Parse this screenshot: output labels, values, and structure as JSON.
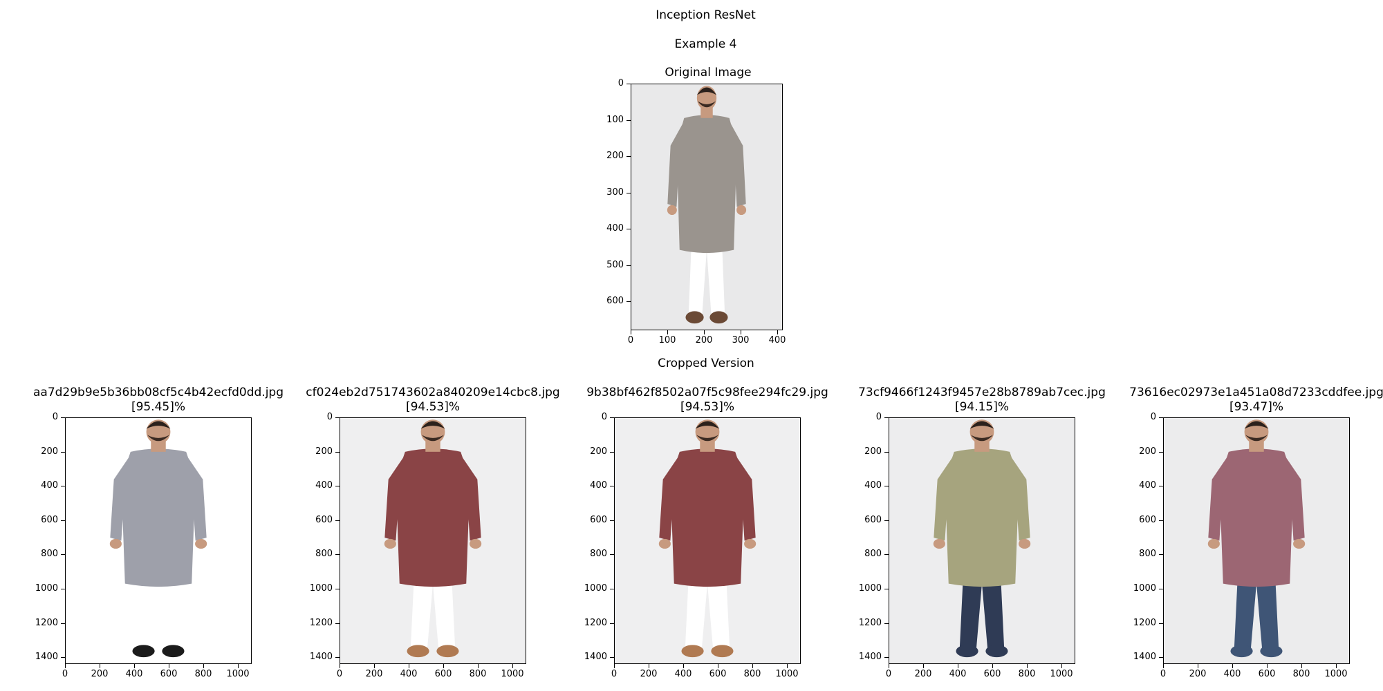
{
  "figure": {
    "title": "Inception ResNet",
    "subtitle": "Example 4"
  },
  "original": {
    "title": "Original Image",
    "y_ticks": [
      "0",
      "100",
      "200",
      "300",
      "400",
      "500",
      "600"
    ],
    "x_ticks": [
      "0",
      "100",
      "200",
      "300",
      "400"
    ],
    "garment_color": "#9a948e",
    "background_color": "#e9e9ea"
  },
  "cropped_title": "Cropped Version",
  "results": [
    {
      "filename": "aa7d29b9e5b36bb08cf5c4b42ecfd0dd.jpg",
      "score": "[95.45]%",
      "garment_color": "#9ea0aa",
      "background_color": "#ffffff",
      "bottom_color": "#ffffff",
      "shoe_color": "#1b1b1b"
    },
    {
      "filename": "cf024eb2d751743602a840209e14cbc8.jpg",
      "score": "[94.53]%",
      "garment_color": "#8a4446",
      "background_color": "#efeff0",
      "bottom_color": "#ffffff",
      "shoe_color": "#b07a52"
    },
    {
      "filename": "9b38bf462f8502a07f5c98fee294fc29.jpg",
      "score": "[94.53]%",
      "garment_color": "#8a4446",
      "background_color": "#efeff0",
      "bottom_color": "#ffffff",
      "shoe_color": "#b07a52"
    },
    {
      "filename": "73cf9466f1243f9457e28b8789ab7cec.jpg",
      "score": "[94.15]%",
      "garment_color": "#a6a47e",
      "background_color": "#ededee",
      "bottom_color": "#2f3b55",
      "shoe_color": "#2f3b55"
    },
    {
      "filename": "73616ec02973e1a451a08d7233cddfee.jpg",
      "score": "[93.47]%",
      "garment_color": "#9c6673",
      "background_color": "#ececed",
      "bottom_color": "#3f5576",
      "shoe_color": "#3f5576"
    }
  ],
  "result_axes": {
    "y_ticks": [
      "0",
      "200",
      "400",
      "600",
      "800",
      "1000",
      "1200",
      "1400"
    ],
    "x_ticks": [
      "0",
      "200",
      "400",
      "600",
      "800",
      "1000"
    ]
  }
}
